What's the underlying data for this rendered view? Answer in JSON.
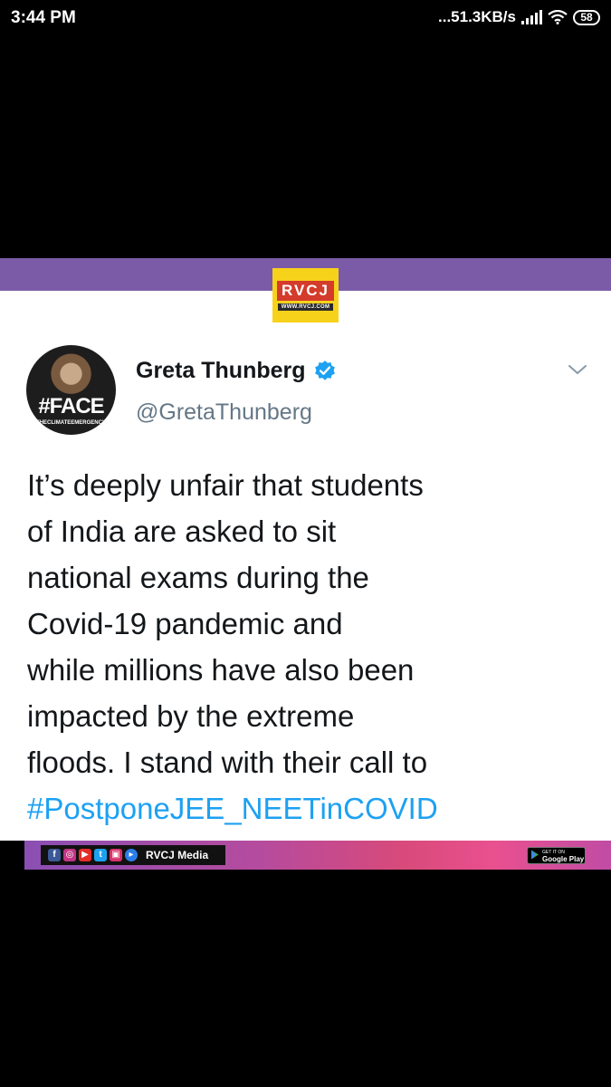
{
  "status_bar": {
    "time": "3:44 PM",
    "network_speed": "...51.3KB/s",
    "battery": "58"
  },
  "logo": {
    "brand": "RVCJ",
    "url": "WWW.RVCJ.COM"
  },
  "tweet": {
    "avatar_text": "#FACE",
    "avatar_subtext": "THECLIMATEEMERGENCY",
    "author_name": "Greta Thunberg",
    "author_handle": "@GretaThunberg",
    "lines": [
      "It’s deeply unfair that students",
      "of India are asked to sit",
      "national exams during the",
      "Covid-19 pandemic and",
      "while millions have also been",
      "impacted by the extreme",
      "floods. I stand with their call to"
    ],
    "hashtag": "#PostponeJEE_NEETinCOVID"
  },
  "footer": {
    "media_label": "RVCJ Media",
    "play_small": "GET IT ON",
    "play_big": "Google Play"
  },
  "colors": {
    "hashtag": "#1da1f2",
    "purple_bar": "#7b5ba7",
    "logo_bg": "#f7d21a",
    "verified": "#1da1f2"
  },
  "icons": [
    "signal-icon",
    "wifi-icon",
    "battery-icon",
    "verified-icon",
    "chevron-down-icon",
    "facebook-icon",
    "instagram-icon",
    "youtube-icon",
    "twitter-icon",
    "app-icon",
    "play-icon",
    "google-play-icon"
  ]
}
